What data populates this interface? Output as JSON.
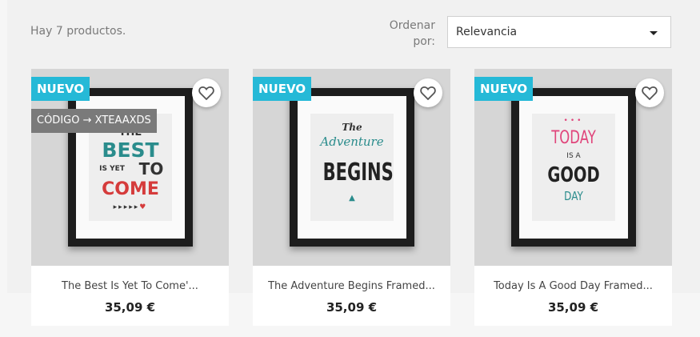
{
  "listing": {
    "count_text": "Hay 7 productos.",
    "sort_label": "Ordenar por:",
    "sort_value": "Relevancia"
  },
  "products": [
    {
      "badge_new": "NUEVO",
      "badge_code": "CÓDIGO → XTEAAXDS",
      "title": "The Best Is Yet To Come'...",
      "price": "35,09 €",
      "poster": {
        "line1": "THE",
        "line2": "BEST",
        "line3a": "IS YET",
        "line3b": "TO",
        "line4": "COME"
      }
    },
    {
      "badge_new": "NUEVO",
      "title": "The Adventure Begins Framed...",
      "price": "35,09 €",
      "poster": {
        "line1": "The",
        "line2": "Adventure",
        "line3": "BEGINS"
      }
    },
    {
      "badge_new": "NUEVO",
      "title": "Today Is A Good Day Framed...",
      "price": "35,09 €",
      "poster": {
        "line1": "TODAY",
        "line2": "IS A",
        "line3": "GOOD",
        "line4": "DAY"
      }
    }
  ],
  "colors": {
    "badge_new": "#25b9d7",
    "badge_code": "#7a7a7a",
    "accent_red": "#d53b3b",
    "accent_teal": "#2a8c8c",
    "accent_pink": "#e0457b"
  },
  "icons": {
    "favorite": "heart-outline-icon",
    "sort_caret": "caret-down-icon"
  }
}
